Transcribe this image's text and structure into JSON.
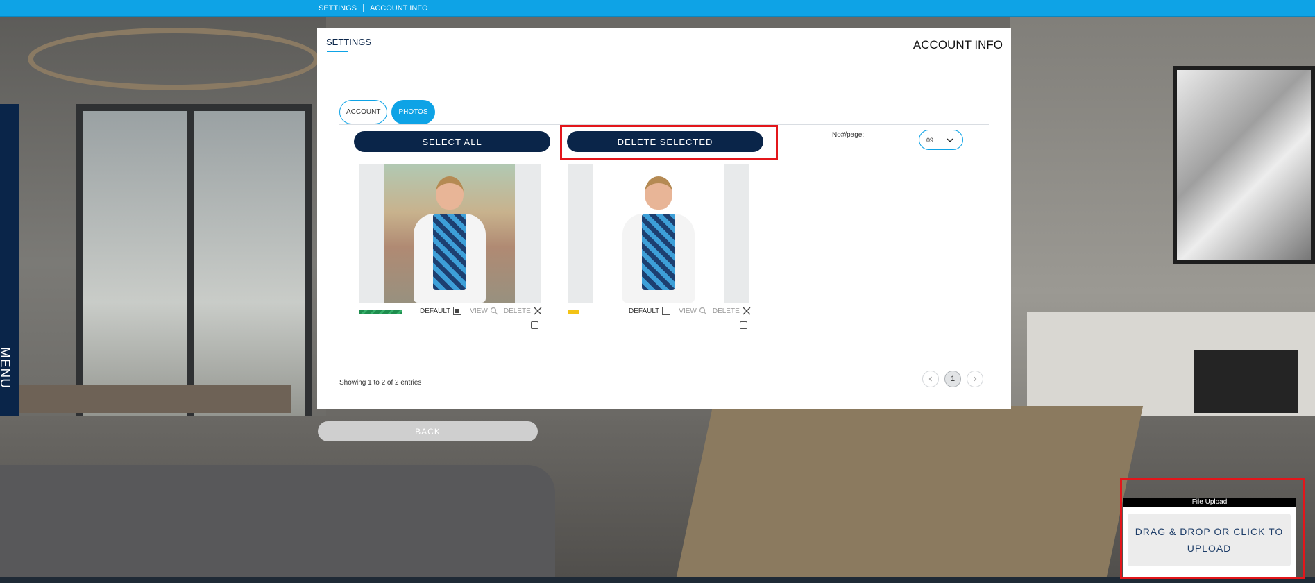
{
  "topbar": {
    "crumbs": [
      "SETTINGS",
      "ACCOUNT INFO"
    ]
  },
  "side_menu": {
    "label": "MENU"
  },
  "panel": {
    "title_left": "SETTINGS",
    "title_right": "ACCOUNT INFO",
    "tabs": [
      {
        "label": "ACCOUNT",
        "active": false
      },
      {
        "label": "PHOTOS",
        "active": true
      }
    ],
    "select_all_label": "SELECT ALL",
    "delete_selected_label": "DELETE SELECTED",
    "per_page_label": "No#/page:",
    "per_page_value": "09",
    "photos": [
      {
        "default_label": "DEFAULT",
        "default_checked": true,
        "view_label": "VIEW",
        "delete_label": "DELETE",
        "bar_color": "#1e8d4e",
        "selected": false
      },
      {
        "default_label": "DEFAULT",
        "default_checked": false,
        "view_label": "VIEW",
        "delete_label": "DELETE",
        "bar_color": "#f3c316",
        "selected": false
      }
    ],
    "entries_text": "Showing 1 to 2 of 2 entries",
    "pagination": {
      "current_page": "1"
    }
  },
  "back_button": {
    "label": "BACK"
  },
  "file_upload": {
    "header": "File Upload",
    "drop_text": "DRAG & DROP OR CLICK TO UPLOAD"
  },
  "colors": {
    "accent": "#0ea3e6",
    "navy": "#0a2549",
    "highlight": "#e3161b"
  }
}
